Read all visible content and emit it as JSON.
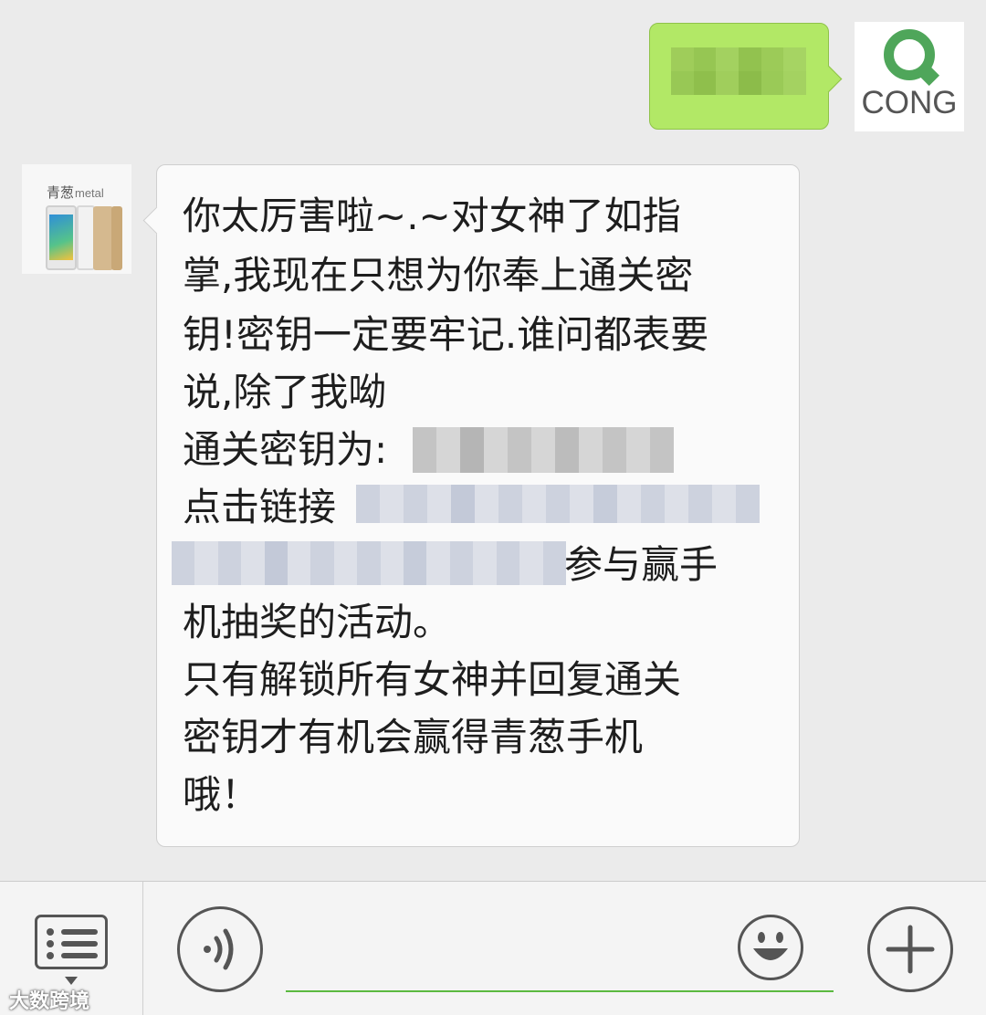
{
  "messages": {
    "outgoing": {
      "avatar_text": "CONG",
      "avatar_icon": "cong-logo-icon",
      "bubble_color": "#b2e866"
    },
    "incoming": {
      "avatar_brand": "青葱",
      "avatar_model": "metal",
      "bubble_color": "#fafafa",
      "lines": [
        "你太厉害啦~.~对女神了如指",
        "掌,我现在只想为你奉上通关密",
        "钥!密钥一定要牢记.谁问都表要",
        "说,除了我呦",
        "通关密钥为:",
        "点击链接",
        "参与赢手",
        "机抽奖的活动。",
        "只有解锁所有女神并回复通关",
        "密钥才有机会赢得青葱手机",
        "哦！"
      ]
    }
  },
  "toolbar": {
    "menu_icon": "list-menu-icon",
    "voice_icon": "voice-icon",
    "emoji_icon": "smiley-icon",
    "plus_icon": "plus-icon",
    "input_value": "",
    "accent_color": "#5bb940"
  },
  "watermark": "大数跨境"
}
